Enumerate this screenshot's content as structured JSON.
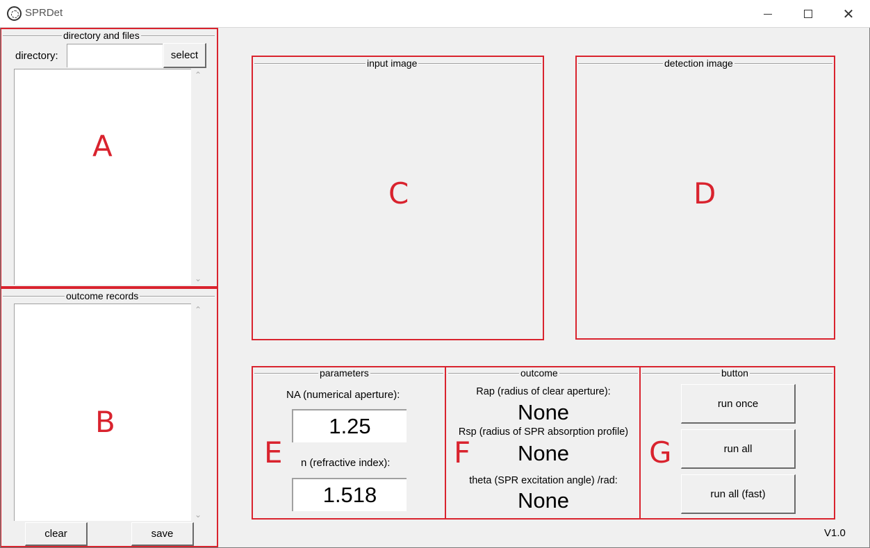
{
  "window": {
    "title": "SPRDet",
    "controls": {
      "minimize": "minimize",
      "maximize": "maximize",
      "close": "✕"
    }
  },
  "directory_panel": {
    "group_label": "directory and files",
    "directory_label": "directory:",
    "directory_value": "",
    "select_button": "select",
    "annotation": "A"
  },
  "outcome_records": {
    "group_label": "outcome records",
    "clear_button": "clear",
    "save_button": "save",
    "annotation": "B"
  },
  "input_image": {
    "group_label": "input image",
    "annotation": "C"
  },
  "detection_image": {
    "group_label": "detection image",
    "annotation": "D"
  },
  "parameters": {
    "group_label": "parameters",
    "na_label": "NA (numerical aperture):",
    "na_value": "1.25",
    "n_label": "n (refractive index):",
    "n_value": "1.518",
    "annotation": "E"
  },
  "outcome": {
    "group_label": "outcome",
    "rap_label": "Rap (radius of clear aperture):",
    "rap_value": "None",
    "rsp_label": "Rsp (radius of SPR absorption profile)",
    "rsp_value": "None",
    "theta_label": "theta (SPR excitation angle) /rad:",
    "theta_value": "None",
    "annotation": "F"
  },
  "buttons": {
    "group_label": "button",
    "run_once": "run once",
    "run_all": "run all",
    "run_all_fast": "run all (fast)",
    "annotation": "G"
  },
  "version": "V1.0",
  "colors": {
    "annotation_red": "#d9232e",
    "background": "#f0f0f0"
  }
}
